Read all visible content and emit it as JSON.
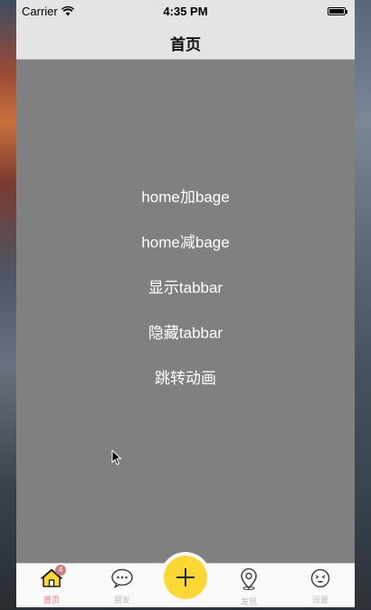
{
  "status_bar": {
    "carrier": "Carrier",
    "time": "4:35 PM"
  },
  "nav": {
    "title": "首页"
  },
  "menu": {
    "items": [
      "home加bage",
      "home减bage",
      "显示tabbar",
      "隐藏tabbar",
      "跳转动画"
    ]
  },
  "tab_bar": {
    "tabs": [
      {
        "label": "首页",
        "icon": "home-icon"
      },
      {
        "label": "朋友",
        "icon": "chat-bubble-icon"
      },
      {
        "label": "发现",
        "icon": "location-pin-icon"
      },
      {
        "label": "设置",
        "icon": "face-icon"
      }
    ],
    "home_badge": "4",
    "center_icon": "plus-icon"
  },
  "colors": {
    "content_background": "#808080",
    "bar_background": "#e4e4e4",
    "active_tab": "#f06b7c",
    "inactive_tab": "#b9b9b9",
    "plus_button": "#fdd835",
    "badge": "#cc7d7d",
    "home_icon_fill": "#fdd835"
  }
}
